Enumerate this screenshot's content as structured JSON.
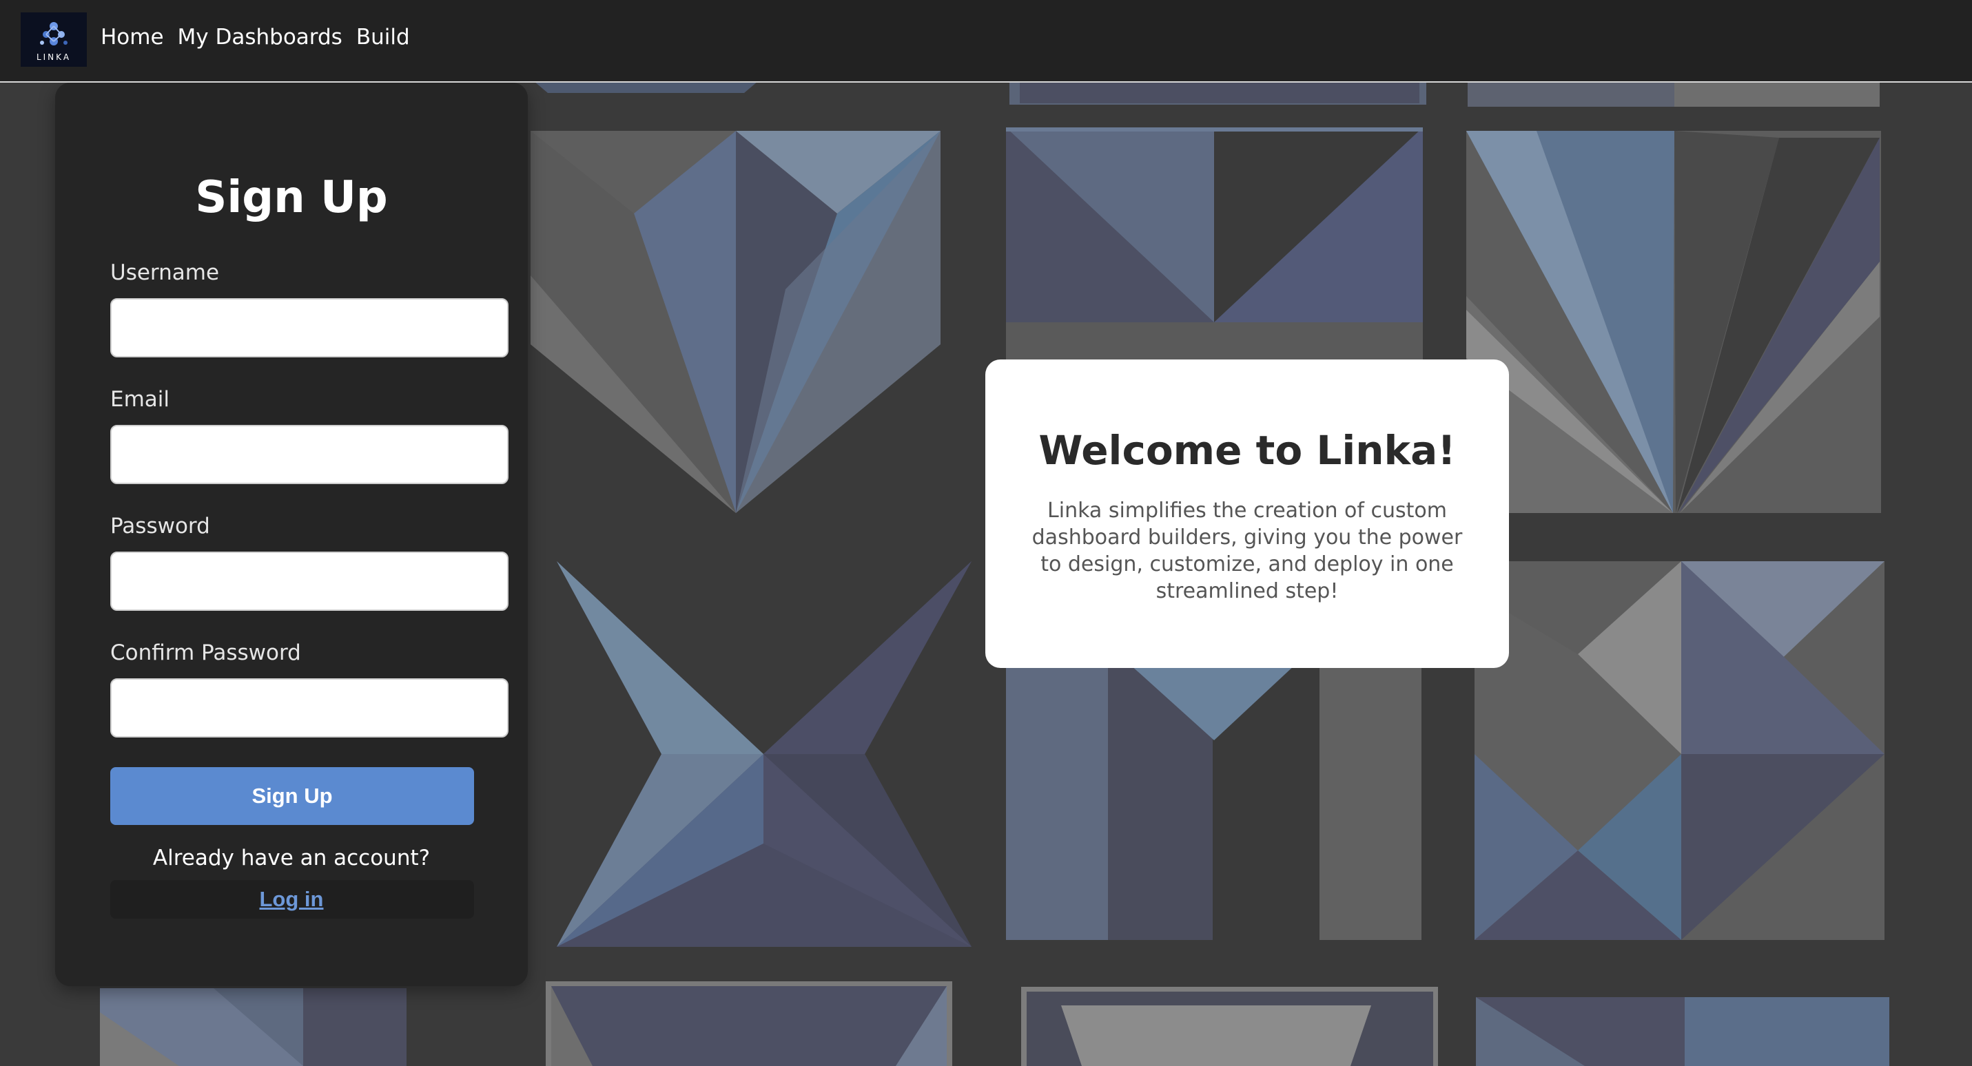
{
  "navbar": {
    "logo_text": "LINKA",
    "links": [
      "Home",
      "My Dashboards",
      "Build"
    ]
  },
  "signup": {
    "title": "Sign Up",
    "fields": {
      "username": {
        "label": "Username",
        "value": ""
      },
      "email": {
        "label": "Email",
        "value": ""
      },
      "password": {
        "label": "Password",
        "value": ""
      },
      "confirm_password": {
        "label": "Confirm Password",
        "value": ""
      }
    },
    "button_label": "Sign Up",
    "already_text": "Already have an account?",
    "login_label": "Log in"
  },
  "welcome": {
    "title": "Welcome to Linka!",
    "text": "Linka simplifies the creation of custom dashboard builders, giving you the power to design, customize, and deploy in one streamlined step!"
  },
  "colors": {
    "navbar_bg": "#222222",
    "page_bg": "#3a3a3a",
    "panel_bg": "#252525",
    "accent": "#5b8ad0",
    "link": "#6d98d8"
  }
}
